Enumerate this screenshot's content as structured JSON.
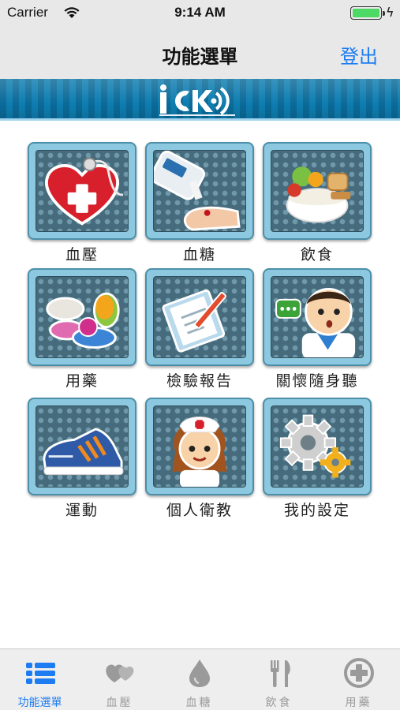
{
  "status_bar": {
    "carrier": "Carrier",
    "time": "9:14 AM",
    "battery_level": 1.0
  },
  "nav": {
    "title": "功能選單",
    "logout_label": "登出"
  },
  "banner": {
    "logo_text": "iCK"
  },
  "menu": {
    "items": [
      {
        "label": "血壓",
        "icon": "heart-stethoscope-icon"
      },
      {
        "label": "血糖",
        "icon": "glucose-meter-icon"
      },
      {
        "label": "飲食",
        "icon": "food-bowl-icon"
      },
      {
        "label": "用藥",
        "icon": "pills-icon"
      },
      {
        "label": "檢驗報告",
        "icon": "clipboard-report-icon"
      },
      {
        "label": "關懷隨身聽",
        "icon": "doctor-chat-icon"
      },
      {
        "label": "運動",
        "icon": "sneaker-icon"
      },
      {
        "label": "個人衛教",
        "icon": "nurse-icon"
      },
      {
        "label": "我的設定",
        "icon": "gears-icon"
      }
    ]
  },
  "tab_bar": {
    "tabs": [
      {
        "label": "功能選單",
        "icon": "list-icon",
        "active": true
      },
      {
        "label": "血壓",
        "icon": "hearts-icon",
        "active": false
      },
      {
        "label": "血糖",
        "icon": "drop-icon",
        "active": false
      },
      {
        "label": "飲食",
        "icon": "utensils-icon",
        "active": false
      },
      {
        "label": "用藥",
        "icon": "medical-cross-icon",
        "active": false
      }
    ]
  },
  "colors": {
    "accent": "#1e7cf2",
    "banner": "#0a6a98",
    "tile_frame": "#8cc9e0",
    "tile_inner": "#456b7c",
    "battery": "#4cd964"
  }
}
